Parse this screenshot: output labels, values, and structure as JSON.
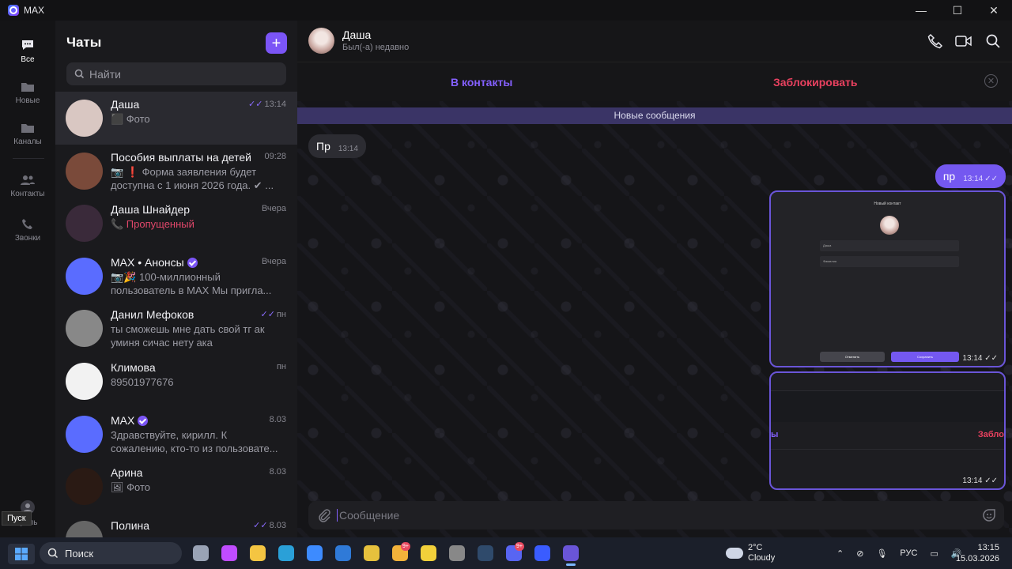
{
  "window": {
    "title": "MAX"
  },
  "rail": {
    "items": [
      {
        "label": "Все",
        "icon": "chat-bubble-icon",
        "active": true
      },
      {
        "label": "Новые",
        "icon": "folder-icon"
      },
      {
        "label": "Каналы",
        "icon": "folder-icon"
      },
      {
        "label": "Контакты",
        "icon": "contacts-icon"
      },
      {
        "label": "Звонки",
        "icon": "phone-icon"
      }
    ],
    "profile_label": "филь",
    "tooltip": "Пуск"
  },
  "chatlist": {
    "title": "Чаты",
    "search_placeholder": "Найти",
    "chats": [
      {
        "name": "Даша",
        "time": "13:14",
        "preview": "⬛ Фото",
        "ticks": true,
        "active": true,
        "avatar": "#d9c7c2"
      },
      {
        "name": "Пособия выплаты на детей",
        "time": "09:28",
        "preview": "📷 ❗ Форма заявления будет доступна с 1 июня 2026 года. ✔ ...",
        "avatar": "#7a4a3a"
      },
      {
        "name": "Даша Шнайдер",
        "time": "Вчера",
        "preview": "📞 Пропущенный",
        "red": true,
        "avatar": "#3a2a3a"
      },
      {
        "name": "MAX • Анонсы",
        "time": "Вчера",
        "preview": "📷🎉 100-миллионный пользователь в MAX  Мы пригла...",
        "verified": true,
        "avatar": "#5a6cff"
      },
      {
        "name": "Данил Мефоков",
        "time": "пн",
        "preview": "ты сможешь мне дать свой тг ак уминя сичас нету ака",
        "ticks": true,
        "avatar": "#888888"
      },
      {
        "name": "Климова",
        "time": "пн",
        "preview": "89501977676",
        "avatar": "#f2f2f2"
      },
      {
        "name": "MAX",
        "time": "8.03",
        "preview": "Здравствуйте, кирилл.  К сожалению, кто-то из пользовате...",
        "verified": true,
        "avatar": "#5a6cff"
      },
      {
        "name": "Арина",
        "time": "8.03",
        "preview": "🖼 Фото",
        "avatar": "#2a1a14"
      },
      {
        "name": "Полина",
        "time": "8.03",
        "preview": "",
        "ticks": true,
        "avatar": "#666666"
      }
    ]
  },
  "conversation": {
    "name": "Даша",
    "status": "Был(-а) недавно",
    "add_contact": "В контакты",
    "block": "Заблокировать",
    "new_messages": "Новые сообщения",
    "messages": [
      {
        "dir": "in",
        "text": "Пр",
        "time": "13:14"
      },
      {
        "dir": "out",
        "text": "пр",
        "time": "13:14"
      }
    ],
    "image1": {
      "time": "13:14",
      "title": "Новый контакт",
      "field1": "Даша",
      "field2": "Фамилия",
      "cancel": "Отменить",
      "save": "Сохранить"
    },
    "image2": {
      "time": "13:14",
      "left_text": "ы",
      "right_text": "Забло"
    },
    "composer_placeholder": "Сообщение"
  },
  "taskbar": {
    "search_label": "Поиск",
    "weather_temp": "2°C",
    "weather_text": "Cloudy",
    "lang": "РУС",
    "time": "13:15",
    "date": "15.03.2026",
    "apps": [
      {
        "name": "task-view",
        "color": "#9aa3b5"
      },
      {
        "name": "copilot",
        "color": "#c04cff"
      },
      {
        "name": "file-explorer",
        "color": "#f4c542"
      },
      {
        "name": "edge",
        "color": "#2aa0d8"
      },
      {
        "name": "store",
        "color": "#3d8bff"
      },
      {
        "name": "outlook",
        "color": "#2f7ad8"
      },
      {
        "name": "chrome",
        "color": "#e6c13d"
      },
      {
        "name": "app-yellow",
        "color": "#f2b23a",
        "badge": "9+"
      },
      {
        "name": "app-star",
        "color": "#f2d03a"
      },
      {
        "name": "app-clock",
        "color": "#888888"
      },
      {
        "name": "steam",
        "color": "#2f4a6b"
      },
      {
        "name": "discord",
        "color": "#5865f2",
        "badge": "9+"
      },
      {
        "name": "roblox",
        "color": "#3a5cff"
      },
      {
        "name": "max",
        "color": "#6a55d8",
        "active": true
      }
    ]
  }
}
